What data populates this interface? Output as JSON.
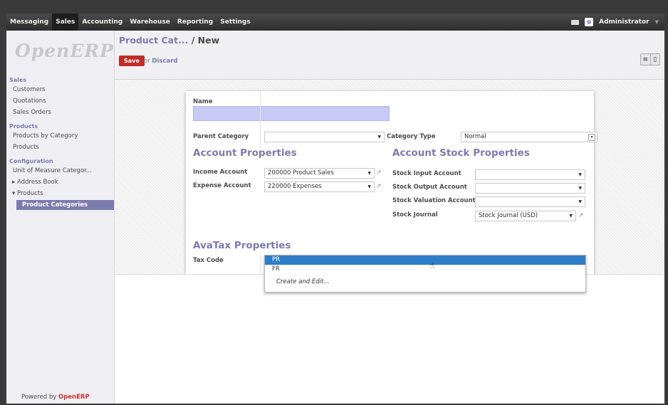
{
  "topbar": {
    "menu": [
      "Messaging",
      "Sales",
      "Accounting",
      "Warehouse",
      "Reporting",
      "Settings"
    ],
    "active": "Sales",
    "user": "Administrator"
  },
  "sidebar": {
    "logo": "OpenERP",
    "sections": [
      {
        "title": "Sales",
        "items": [
          "Customers",
          "Quotations",
          "Sales Orders"
        ]
      },
      {
        "title": "Products",
        "items": [
          "Products by Category",
          "Products"
        ]
      },
      {
        "title": "Configuration",
        "items": [
          "Unit of Measure Categor...",
          "Address Book",
          "Products",
          "Product Categories"
        ]
      }
    ],
    "powered_prefix": "Powered by",
    "powered_brand": "OpenERP"
  },
  "header": {
    "breadcrumb_parent": "Product Cat...",
    "breadcrumb_sep": "/",
    "breadcrumb_current": "New",
    "save_label": "Save",
    "or_text": "or",
    "discard_label": "Discard"
  },
  "form": {
    "name_label": "Name",
    "name_value": "",
    "parent_category_label": "Parent Category",
    "parent_category_value": "",
    "category_type_label": "Category Type",
    "category_type_value": "Normal",
    "account_section": "Account Properties",
    "income_label": "Income Account",
    "income_value": "200000 Product Sales",
    "expense_label": "Expense Account",
    "expense_value": "220000 Expenses",
    "stock_section": "Account Stock Properties",
    "stock_input_label": "Stock Input Account",
    "stock_output_label": "Stock Output Account",
    "stock_valuation_label": "Stock Valuation Account",
    "stock_journal_label": "Stock Journal",
    "stock_journal_value": "Stock Journal (USD)",
    "avatax_section": "AvaTax Properties",
    "tax_code_label": "Tax Code",
    "tax_code_value": ""
  },
  "dropdown": {
    "options": [
      "PR",
      "FR"
    ],
    "highlighted": "PR",
    "create_label": "Create and Edit..."
  }
}
